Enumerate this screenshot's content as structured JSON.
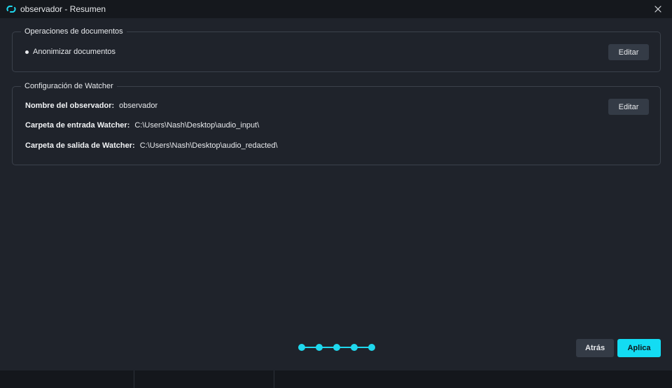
{
  "window": {
    "title": "observador - Resumen",
    "logo_icon": "sync-loop-icon",
    "close_icon": "close-icon"
  },
  "document_operations": {
    "legend": "Operaciones de documentos",
    "items": [
      "Anonimizar documentos"
    ],
    "edit_label": "Editar"
  },
  "watcher_config": {
    "legend": "Configuración de Watcher",
    "edit_label": "Editar",
    "fields": [
      {
        "label": "Nombre del observador:",
        "value": "observador"
      },
      {
        "label": "Carpeta de entrada Watcher:",
        "value": "C:\\Users\\Nash\\Desktop\\audio_input\\"
      },
      {
        "label": "Carpeta de salida de Watcher:",
        "value": "C:\\Users\\Nash\\Desktop\\audio_redacted\\"
      }
    ]
  },
  "stepper": {
    "total_steps": 5,
    "completed_steps": 5,
    "color": "#1fd8ee"
  },
  "footer": {
    "back_label": "Atrás",
    "apply_label": "Aplica"
  },
  "colors": {
    "background": "#1f232b",
    "titlebar": "#15181d",
    "accent": "#13dcf3",
    "secondary_button": "#343b46"
  }
}
